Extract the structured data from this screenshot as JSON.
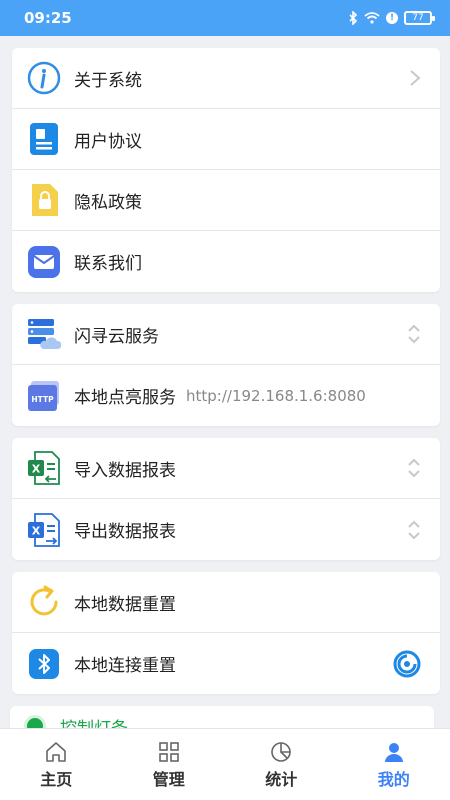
{
  "status_bar": {
    "time": "09:25",
    "battery": "77"
  },
  "groups": [
    {
      "items": [
        {
          "label": "关于系统",
          "icon": "info-icon",
          "right": "chevron-right-icon"
        },
        {
          "label": "用户协议",
          "icon": "document-icon"
        },
        {
          "label": "隐私政策",
          "icon": "lock-icon"
        },
        {
          "label": "联系我们",
          "icon": "mail-icon"
        }
      ]
    },
    {
      "items": [
        {
          "label": "闪寻云服务",
          "icon": "cloud-server-icon",
          "right": "expand-icon"
        },
        {
          "label": "本地点亮服务",
          "icon": "http-icon",
          "sub": "http://192.168.1.6:8080"
        }
      ]
    },
    {
      "items": [
        {
          "label": "导入数据报表",
          "icon": "excel-import-icon",
          "right": "expand-icon"
        },
        {
          "label": "导出数据报表",
          "icon": "excel-export-icon",
          "right": "expand-icon"
        }
      ]
    },
    {
      "items": [
        {
          "label": "本地数据重置",
          "icon": "refresh-icon"
        },
        {
          "label": "本地连接重置",
          "icon": "bluetooth-icon",
          "right": "loading-icon"
        }
      ]
    },
    {
      "items": [
        {
          "label": "控制灯条",
          "icon": "green-dot-icon"
        }
      ]
    }
  ],
  "tabbar": {
    "tabs": [
      {
        "label": "主页",
        "icon": "home-icon"
      },
      {
        "label": "管理",
        "icon": "grid-icon"
      },
      {
        "label": "统计",
        "icon": "pie-chart-icon"
      },
      {
        "label": "我的",
        "icon": "user-icon",
        "active": true
      }
    ]
  },
  "colors": {
    "status_bar": "#4aa3f6",
    "accent": "#3c82f6",
    "green": "#19a84b"
  }
}
